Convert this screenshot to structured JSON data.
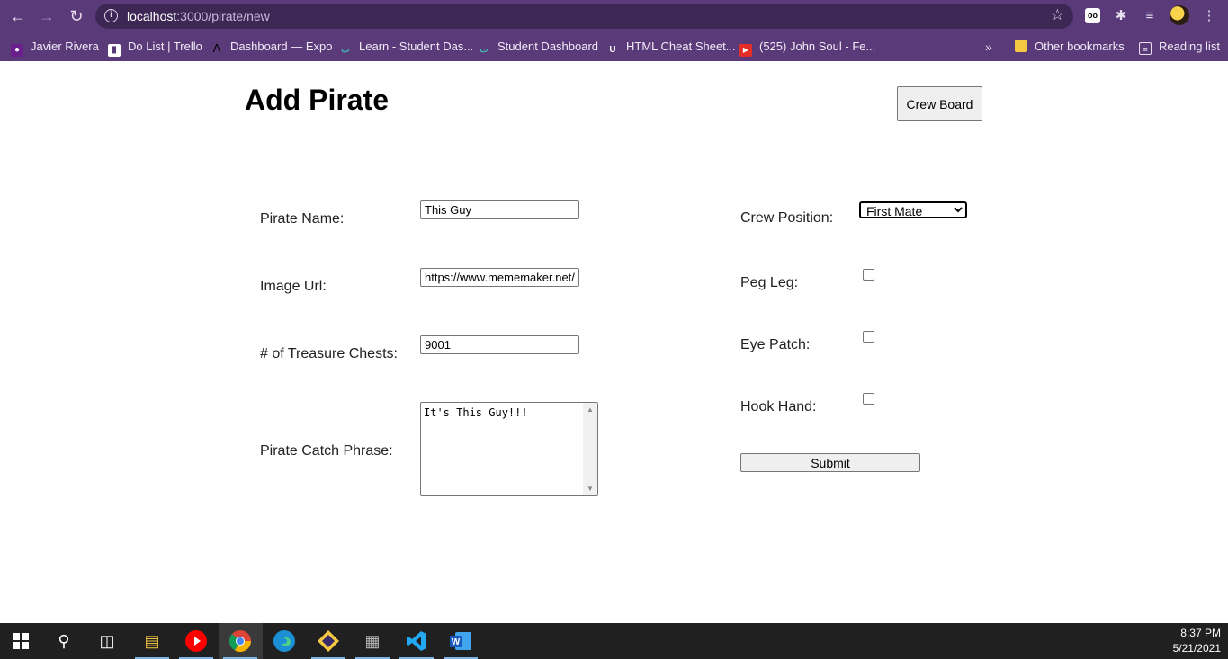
{
  "browser": {
    "url_host": "localhost",
    "url_path": ":3000/pirate/new",
    "bookmarks": [
      {
        "label": "Javier Rivera",
        "icon": "instagram-icon"
      },
      {
        "label": "Do List | Trello",
        "icon": "trello-icon"
      },
      {
        "label": "Dashboard — Expo",
        "icon": "expo-icon"
      },
      {
        "label": "Learn - Student Das...",
        "icon": "torii-icon"
      },
      {
        "label": "Student Dashboard",
        "icon": "torii-icon"
      },
      {
        "label": "HTML Cheat Sheet...",
        "icon": "shield-icon"
      },
      {
        "label": "(525) John Soul - Fe...",
        "icon": "youtube-icon"
      }
    ],
    "more_bookmarks": "»",
    "other_bookmarks": "Other bookmarks",
    "reading_list": "Reading list"
  },
  "page": {
    "title": "Add Pirate",
    "crew_board_button": "Crew Board",
    "form": {
      "pirate_name_label": "Pirate Name:",
      "pirate_name_value": "This Guy",
      "image_url_label": "Image Url:",
      "image_url_value": "https://www.mememaker.net/",
      "treasure_label": "# of Treasure Chests:",
      "treasure_value": "9001",
      "catch_phrase_label": "Pirate Catch Phrase:",
      "catch_phrase_value": "It's This Guy!!!",
      "crew_position_label": "Crew Position:",
      "crew_position_value": "First Mate",
      "peg_leg_label": "Peg Leg:",
      "eye_patch_label": "Eye Patch:",
      "hook_hand_label": "Hook Hand:",
      "submit_label": "Submit"
    }
  },
  "taskbar": {
    "time": "8:37 PM",
    "date": "5/21/2021"
  }
}
